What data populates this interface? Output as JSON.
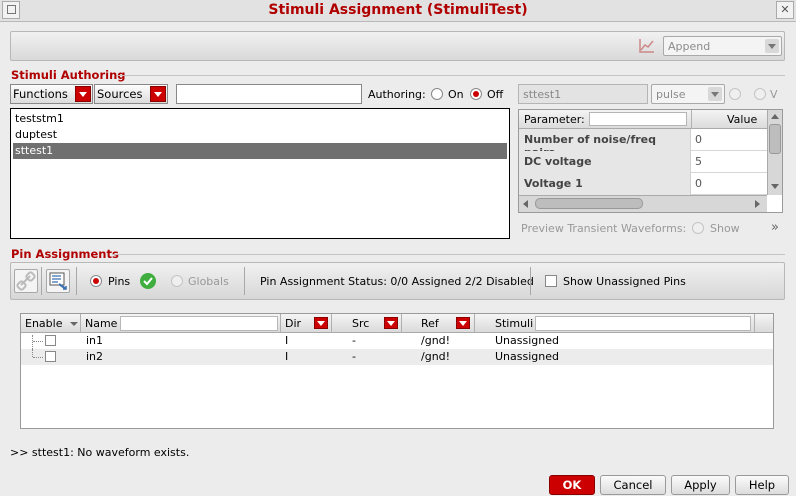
{
  "window": {
    "title": "Stimuli Assignment (StimuliTest)"
  },
  "top_toolbar": {
    "mode_select": "Append"
  },
  "stimuli_authoring": {
    "section_title": "Stimuli Authoring",
    "functions_dropdown": "Functions",
    "sources_dropdown": "Sources",
    "filter_value": "",
    "authoring_label": "Authoring:",
    "authoring_on": "On",
    "authoring_off": "Off",
    "authoring_selected": "Off",
    "stimuli_list": [
      "teststm1",
      "duptest",
      "sttest1"
    ],
    "selected_stimulus": "sttest1",
    "name_field": "sttest1",
    "type_select": "pulse",
    "radio_v_label": "V"
  },
  "parameters": {
    "header_param": "Parameter:",
    "header_value": "Value",
    "rows": [
      {
        "name": "Number of noise/freq pairs",
        "value": "0"
      },
      {
        "name": "DC voltage",
        "value": "5"
      },
      {
        "name": "Voltage 1",
        "value": "0"
      }
    ],
    "preview_label": "Preview Transient Waveforms:",
    "preview_show": "Show",
    "expand_glyph": "»"
  },
  "pin_assignments": {
    "section_title": "Pin Assignments",
    "pins_label": "Pins",
    "globals_label": "Globals",
    "status_text": "Pin Assignment Status: 0/0 Assigned  2/2 Disabled",
    "show_unassigned_label": "Show Unassigned Pins",
    "columns": {
      "enable": "Enable",
      "name": "Name",
      "dir": "Dir",
      "src": "Src",
      "ref": "Ref",
      "stimuli": "Stimuli"
    },
    "rows": [
      {
        "name": "in1",
        "dir": "I",
        "src": "-",
        "ref": "/gnd!",
        "stimuli": "Unassigned"
      },
      {
        "name": "in2",
        "dir": "I",
        "src": "-",
        "ref": "/gnd!",
        "stimuli": "Unassigned"
      }
    ]
  },
  "status_message": ">> sttest1: No waveform exists.",
  "buttons": {
    "ok": "OK",
    "cancel": "Cancel",
    "apply": "Apply",
    "help": "Help"
  },
  "colors": {
    "accent": "#cc0000",
    "selection": "#707070"
  }
}
